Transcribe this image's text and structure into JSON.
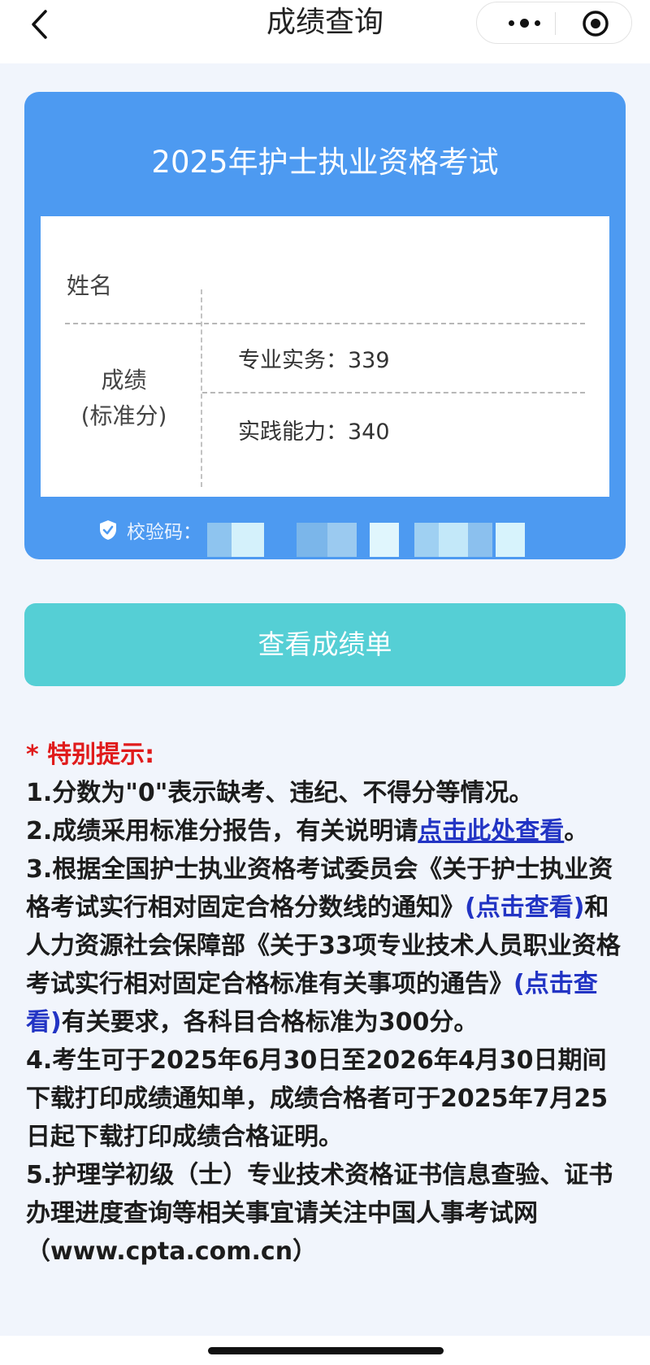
{
  "nav": {
    "title": "成绩查询",
    "back_icon": "chevron-left-icon",
    "more_icon": "more-dots-icon",
    "close_icon": "target-circle-icon"
  },
  "card": {
    "title": "2025年护士执业资格考试",
    "name_label": "姓名",
    "score_label_line1": "成绩",
    "score_label_line2": "(标准分)",
    "scores": [
      {
        "subject": "专业实务：",
        "value": "339"
      },
      {
        "subject": "实践能力：",
        "value": "340"
      }
    ],
    "verify_label": "校验码：",
    "verify_icon": "shield-check-icon"
  },
  "button": {
    "label": "查看成绩单"
  },
  "notice": {
    "heading": "* 特别提示:",
    "item1": "1.分数为\"0\"表示缺考、违纪、不得分等情况。",
    "item2_prefix": "2.成绩采用标准分报告，有关说明请",
    "item2_link": "点击此处查看",
    "item2_suffix": "。",
    "item3_a": "3.根据全国护士执业资格考试委员会《关于护士执业资格考试实行相对固定合格分数线的通知》",
    "item3_link1": "(点击查看)",
    "item3_b": "和人力资源社会保障部《关于33项专业技术人员职业资格考试实行相对固定合格标准有关事项的通告》",
    "item3_link2": "(点击查看)",
    "item3_c": "有关要求，各科目合格标准为300分。",
    "item4": "4.考生可于2025年6月30日至2026年4月30日期间下载打印成绩通知单，成绩合格者可于2025年7月25日起下载打印成绩合格证明。",
    "item5": "5.护理学初级（士）专业技术资格证书信息查验、证书办理进度查询等相关事宜请关注中国人事考试网（www.cpta.com.cn）"
  },
  "colors": {
    "card_blue": "#4d9af1",
    "button_teal": "#55cfd5",
    "warning_red": "#e01b1b",
    "link_blue": "#2234c4"
  }
}
